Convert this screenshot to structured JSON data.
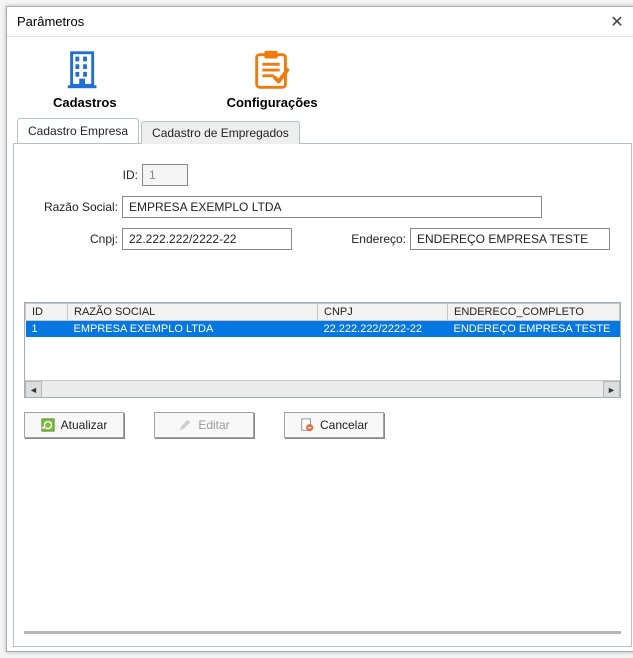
{
  "window": {
    "title": "Parâmetros"
  },
  "big_tabs": {
    "cadastros": "Cadastros",
    "config": "Configurações"
  },
  "tabs": {
    "empresa": "Cadastro Empresa",
    "empregados": "Cadastro de Empregados"
  },
  "form": {
    "labels": {
      "id": "ID:",
      "razao": "Razão Social:",
      "cnpj": "Cnpj:",
      "endereco": "Endereço:"
    },
    "values": {
      "id": "1",
      "razao": "EMPRESA EXEMPLO LTDA",
      "cnpj": "22.222.222/2222-22",
      "endereco": "ENDEREÇO EMPRESA TESTE"
    }
  },
  "grid": {
    "headers": {
      "id": "ID",
      "razao": "RAZÃO SOCIAL",
      "cnpj": "CNPJ",
      "endereco": "ENDERECO_COMPLETO"
    },
    "rows": [
      {
        "id": "1",
        "razao": "EMPRESA EXEMPLO LTDA",
        "cnpj": "22.222.222/2222-22",
        "endereco": "ENDEREÇO EMPRESA TESTE"
      }
    ]
  },
  "buttons": {
    "atualizar": "Atualizar",
    "editar": "Editar",
    "cancelar": "Cancelar"
  }
}
